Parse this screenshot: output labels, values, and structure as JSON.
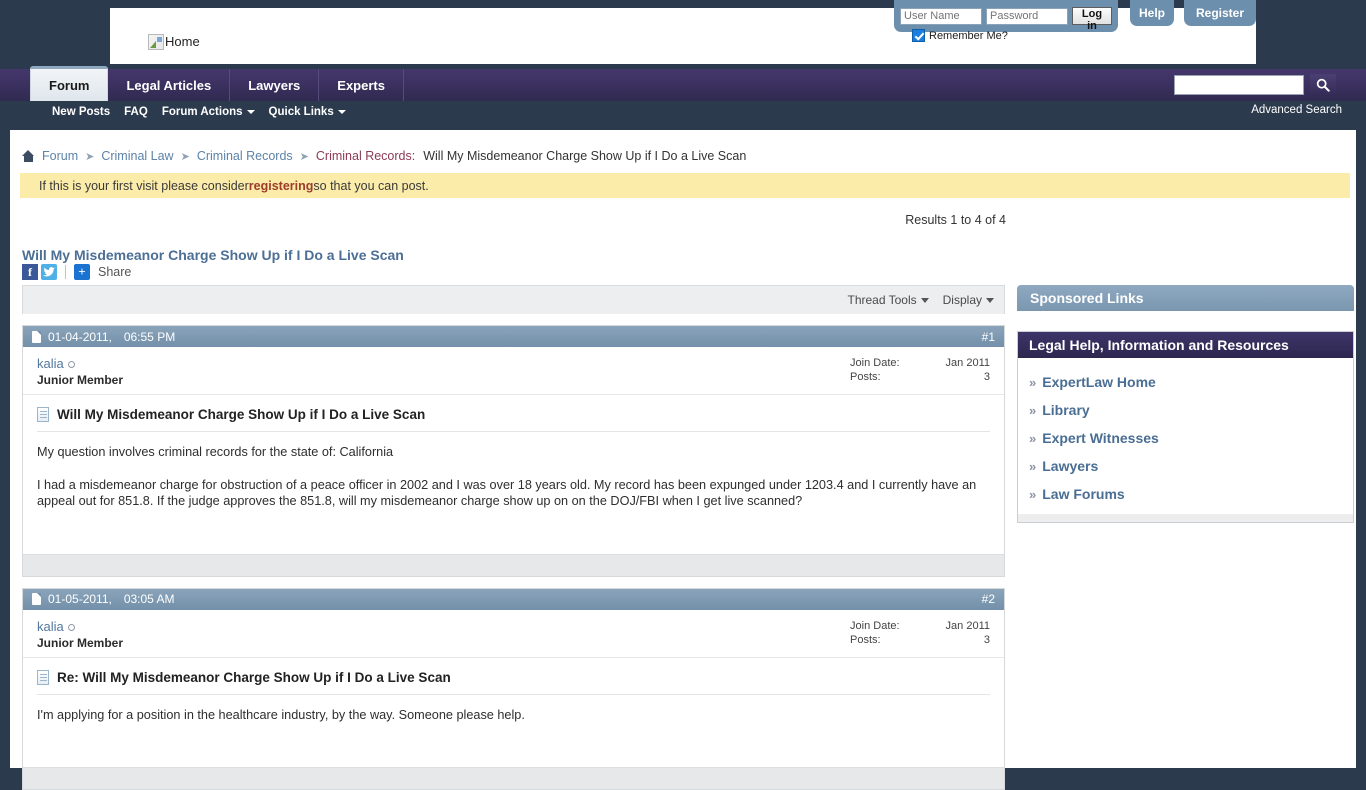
{
  "header": {
    "logo_alt": "Home",
    "login": {
      "username_placeholder": "User Name",
      "password_placeholder": "Password",
      "login_button": "Log in",
      "remember_label": "Remember Me?"
    },
    "help_label": "Help",
    "register_label": "Register"
  },
  "nav": {
    "tabs": [
      {
        "label": "Forum",
        "active": true
      },
      {
        "label": "Legal Articles",
        "active": false
      },
      {
        "label": "Lawyers",
        "active": false
      },
      {
        "label": "Experts",
        "active": false
      }
    ],
    "search_value": "",
    "search_icon": "search-icon",
    "advanced_search": "Advanced Search",
    "sub_items": [
      {
        "label": "New Posts",
        "caret": false
      },
      {
        "label": "FAQ",
        "caret": false
      },
      {
        "label": "Forum Actions",
        "caret": true
      },
      {
        "label": "Quick Links",
        "caret": true
      }
    ]
  },
  "breadcrumb": {
    "home_icon": "home-icon",
    "items": [
      "Forum",
      "Criminal Law",
      "Criminal Records"
    ],
    "current": "Criminal Records:",
    "title": "Will My Misdemeanor Charge Show Up if I Do a Live Scan"
  },
  "notice": {
    "before": "If this is your first visit please consider ",
    "link": "registering",
    "after": " so that you can post."
  },
  "results": "Results 1 to 4 of 4",
  "thread": {
    "title": "Will My Misdemeanor Charge Show Up if I Do a Live Scan",
    "share_label": "Share",
    "facebook_glyph": "f",
    "twitter_glyph": "t",
    "plus_glyph": "+",
    "toolbar": {
      "thread_tools": "Thread Tools",
      "display": "Display"
    }
  },
  "posts": [
    {
      "date": "01-04-2011,",
      "time": "06:55 PM",
      "number": "#1",
      "user": "kalia",
      "rank": "Junior Member",
      "join_label": "Join Date:",
      "join_value": "Jan 2011",
      "posts_label": "Posts:",
      "posts_value": "3",
      "subject": "Will My Misdemeanor Charge Show Up if I Do a Live Scan",
      "paragraph1": "My question involves criminal records for the state of: California",
      "paragraph2": "I had a misdemeanor charge for obstruction of a peace officer in 2002 and I was over 18 years old. My record has been expunged under 1203.4 and I currently have an appeal out for 851.8. If the judge approves the 851.8, will my misdemeanor charge show up on on the DOJ/FBI when I get live scanned?"
    },
    {
      "date": "01-05-2011,",
      "time": "03:05 AM",
      "number": "#2",
      "user": "kalia",
      "rank": "Junior Member",
      "join_label": "Join Date:",
      "join_value": "Jan 2011",
      "posts_label": "Posts:",
      "posts_value": "3",
      "subject": "Re: Will My Misdemeanor Charge Show Up if I Do a Live Scan",
      "paragraph1": "I'm applying for a position in the healthcare industry, by the way. Someone please help.",
      "paragraph2": ""
    }
  ],
  "sidebar": {
    "sponsored_title": "Sponsored Links",
    "resources_title": "Legal Help, Information and Resources",
    "arrow_glyph": "»",
    "links": [
      "ExpertLaw Home",
      "Library",
      "Expert Witnesses",
      "Lawyers",
      "Law Forums"
    ]
  },
  "colors": {
    "page_bg": "#2c3a4d",
    "nav_purple": "#3b3160",
    "post_header": "#7a95ad",
    "notice_yellow": "#fcecaa",
    "link_blue": "#4d6f96",
    "breadcrumb_current": "#8c3a55"
  }
}
